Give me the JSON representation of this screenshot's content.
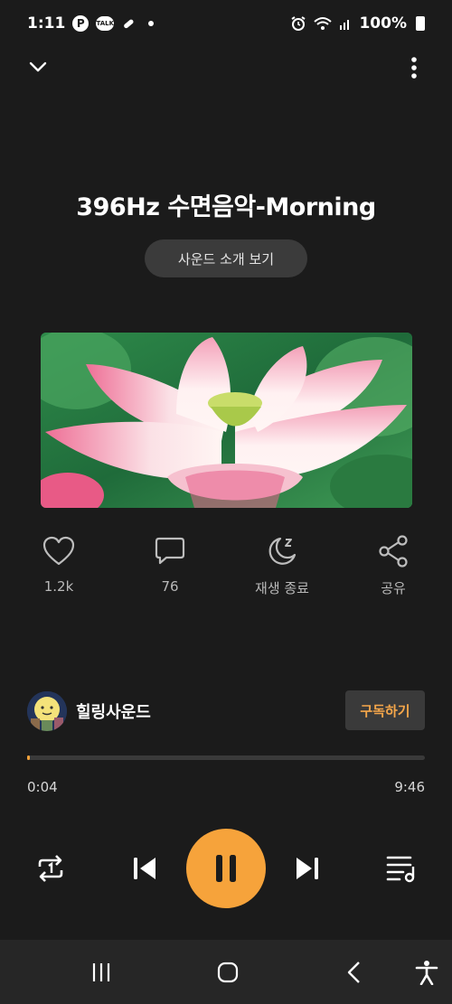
{
  "status_bar": {
    "time": "1:11",
    "app_badge_p": "P",
    "app_badge_talk": "TALK",
    "battery": "100%"
  },
  "track": {
    "title": "396Hz 수면음악-Morning",
    "intro_button": "사운드 소개 보기"
  },
  "actions": {
    "likes": "1.2k",
    "comments": "76",
    "sleep_timer": "재생 종료",
    "share": "공유"
  },
  "channel": {
    "name": "힐링사운드",
    "subscribe_label": "구독하기"
  },
  "playback": {
    "current_time": "0:04",
    "total_time": "9:46",
    "progress": 0.007,
    "is_playing": true
  },
  "colors": {
    "accent": "#f6a33b",
    "background": "#1b1b1b"
  },
  "icons": {
    "collapse": "chevron-down-icon",
    "more": "more-vertical-icon",
    "like": "heart-icon",
    "comment": "comment-icon",
    "sleep": "moon-icon",
    "share": "share-icon",
    "repeat": "repeat-one-icon",
    "previous": "skip-previous-icon",
    "pause": "pause-icon",
    "next": "skip-next-icon",
    "playlist": "playlist-icon"
  }
}
